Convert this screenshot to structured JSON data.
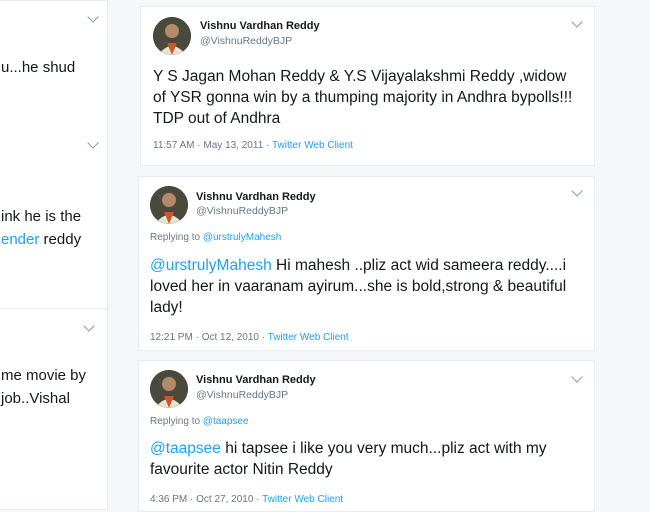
{
  "left_column": {
    "line1": "u...he shud",
    "line2": "ink he is the",
    "line3_link": "ender",
    "line3_rest": " reddy",
    "line4": "me movie by",
    "line5": "job..Vishal"
  },
  "tweets": [
    {
      "author": "Vishnu Vardhan Reddy",
      "handle": "@VishnuReddyBJP",
      "text": "Y S Jagan Mohan Reddy & Y.S Vijayalakshmi Reddy ,widow of YSR gonna win by a thumping majority in Andhra bypolls!!! TDP out of Andhra",
      "time": "11:57 AM · May 13, 2011 · ",
      "source": "Twitter Web Client"
    },
    {
      "author": "Vishnu Vardhan Reddy",
      "handle": "@VishnuReddyBJP",
      "replying_prefix": "Replying to ",
      "replying_to": "@urstrulyMahesh",
      "mention": "@urstrulyMahesh",
      "text": " Hi mahesh ..pliz act wid sameera reddy....i loved her in vaaranam ayirum...she is bold,strong & beautiful lady!",
      "time": "12:21 PM · Oct 12, 2010 · ",
      "source": "Twitter Web Client"
    },
    {
      "author": "Vishnu Vardhan Reddy",
      "handle": "@VishnuReddyBJP",
      "replying_prefix": "Replying to ",
      "replying_to": "@taapsee",
      "mention": "@taapsee",
      "text": " hi tapsee i like you very much...pliz act with my favourite actor Nitin Reddy",
      "time": "4:36 PM · Oct 27, 2010 · ",
      "source": "Twitter Web Client"
    }
  ],
  "colors": {
    "link": "#1da1f2",
    "muted": "#657786",
    "text": "#14171a",
    "border": "#e6ecf0"
  },
  "icons": [
    "chevron-down-icon",
    "avatar"
  ]
}
